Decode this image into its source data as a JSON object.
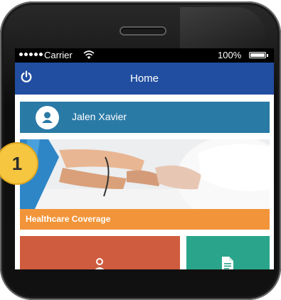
{
  "status_bar": {
    "carrier": "Carrier",
    "battery": "100%"
  },
  "nav": {
    "title": "Home"
  },
  "user": {
    "name": "Jalen Xavier"
  },
  "banner": {
    "label": "Healthcare Coverage"
  },
  "overlay": {
    "step_badge": "1"
  },
  "colors": {
    "nav": "#214ea0",
    "user_bar": "#2a7aa6",
    "coverage": "#f2953a",
    "tile_red": "#cf5c3f",
    "tile_green": "#2aa58b",
    "badge": "#f6c640"
  },
  "icons": {
    "power": "power-icon",
    "avatar": "user-icon",
    "doctor": "doctor-icon",
    "document": "document-icon"
  }
}
